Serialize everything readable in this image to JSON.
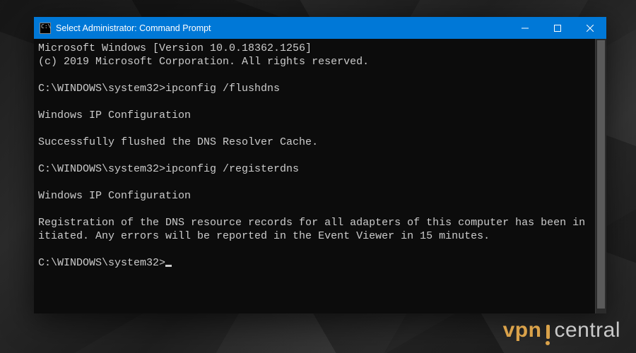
{
  "window": {
    "title": "Select Administrator: Command Prompt",
    "icon_name": "cmd-icon"
  },
  "terminal": {
    "lines": [
      "Microsoft Windows [Version 10.0.18362.1256]",
      "(c) 2019 Microsoft Corporation. All rights reserved.",
      "",
      "C:\\WINDOWS\\system32>ipconfig /flushdns",
      "",
      "Windows IP Configuration",
      "",
      "Successfully flushed the DNS Resolver Cache.",
      "",
      "C:\\WINDOWS\\system32>ipconfig /registerdns",
      "",
      "Windows IP Configuration",
      "",
      "Registration of the DNS resource records for all adapters of this computer has been initiated. Any errors will be reported in the Event Viewer in 15 minutes.",
      "",
      "C:\\WINDOWS\\system32>"
    ],
    "prompt": "C:\\WINDOWS\\system32>",
    "commands": [
      "ipconfig /flushdns",
      "ipconfig /registerdns"
    ]
  },
  "watermark": {
    "left": "vpn",
    "right": "central"
  },
  "colors": {
    "titlebar": "#0078d7",
    "terminal_bg": "#0c0c0c",
    "terminal_fg": "#cccccc",
    "watermark_accent": "#daa24a"
  }
}
